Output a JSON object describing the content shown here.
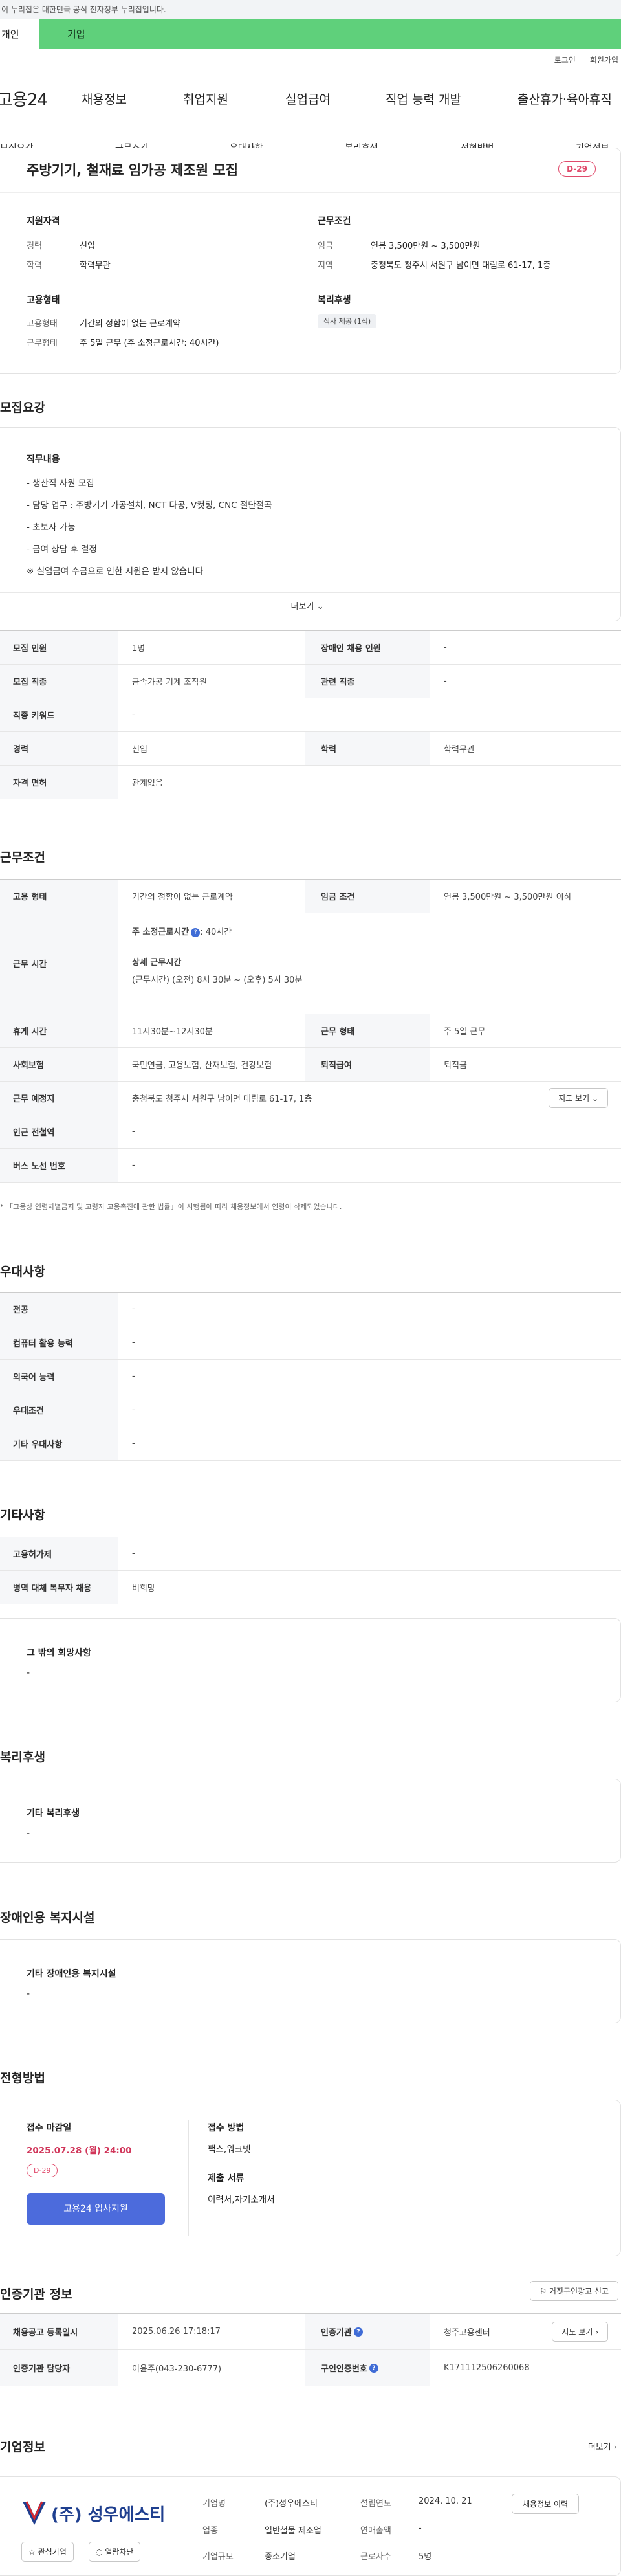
{
  "gov_banner": "이 누리집은 대한민국 공식 전자정부 누리집입니다.",
  "user_tabs": {
    "personal": "개인",
    "business": "기업"
  },
  "util": {
    "login": "로그인",
    "signup": "회원가입"
  },
  "gnb": {
    "logo": "고용24",
    "items": [
      "채용정보",
      "취업지원",
      "실업급여",
      "직업 능력 개발",
      "출산휴가·육아휴직"
    ]
  },
  "subnav": [
    "모집요강",
    "근무조건",
    "우대사항",
    "복리후생",
    "전형방법",
    "기업정보"
  ],
  "hero": {
    "title": "주방기기, 철재료 임가공 제조원 모집",
    "dday": "D-29",
    "qual_title": "지원자격",
    "qual": [
      {
        "k": "경력",
        "v": "신입"
      },
      {
        "k": "학력",
        "v": "학력무관"
      }
    ],
    "work_title": "근무조건",
    "work": [
      {
        "k": "임금",
        "v": "연봉 3,500만원 ~ 3,500만원"
      },
      {
        "k": "지역",
        "v": "충청북도 청주시 서원구 남이면 대림로 61-17, 1층"
      }
    ],
    "emp_title": "고용형태",
    "emp": [
      {
        "k": "고용형태",
        "v": "기간의 정함이 없는 근로계약"
      },
      {
        "k": "근무형태",
        "v": "주 5일 근무 (주 소정근로시간: 40시간)"
      }
    ],
    "welfare_title": "복리후생",
    "welfare_tag": "식사 제공 (1식)"
  },
  "recruit": {
    "heading": "모집요강",
    "desc_title": "직무내용",
    "desc_lines": [
      "- 생산직 사원 모집",
      "- 담당 업무 : 주방기기 가공설치, NCT 타공, V컷팅, CNC 절단절곡",
      "- 초보자 가능",
      "- 급여 상담 후 결정",
      "※ 실업급여 수급으로 인한 지원은 받지 않습니다"
    ],
    "more": "더보기",
    "rows": [
      {
        "k1": "모집 인원",
        "v1": "1명",
        "k2": "장애인 채용 인원",
        "v2": "-"
      },
      {
        "k1": "모집 직종",
        "v1": "금속가공 기계 조작원",
        "k2": "관련 직종",
        "v2": "-"
      },
      {
        "k1": "직종 키워드",
        "v1": "-"
      },
      {
        "k1": "경력",
        "v1": "신입",
        "k2": "학력",
        "v2": "학력무관"
      },
      {
        "k1": "자격 면허",
        "v1": "관계없음"
      }
    ]
  },
  "conditions": {
    "heading": "근무조건",
    "emp_type_k": "고용 형태",
    "emp_type_v": "기간의 정함이 없는 근로계약",
    "wage_k": "임금 조건",
    "wage_v": "연봉 3,500만원 ~ 3,500만원 이하",
    "time_k": "근무 시간",
    "time_main": "주 소정근로시간",
    "time_hours": ": 40시간",
    "time_detail_title": "상세 근무시간",
    "time_detail": "(근무시간) (오전) 8시 30분 ~ (오후) 5시 30분",
    "break_k": "휴게 시간",
    "break_v": "11시30분~12시30분",
    "form_k": "근무 형태",
    "form_v": "주 5일 근무",
    "ins_k": "사회보험",
    "ins_v": "국민연금, 고용보험, 산재보험, 건강보험",
    "ret_k": "퇴직급여",
    "ret_v": "퇴직금",
    "place_k": "근무 예정지",
    "place_v": "충청북도 청주시 서원구 남이면 대림로 61-17, 1층",
    "map_btn": "지도 보기",
    "sub_k": "인근 전철역",
    "sub_v": "-",
    "bus_k": "버스 노선 번호",
    "bus_v": "-",
    "note": "* 「고용상 연령차별금지 및 고령자 고용촉진에 관한 법률」이 시행됨에 따라 채용정보에서 연령이 삭제되었습니다."
  },
  "preference": {
    "heading": "우대사항",
    "rows": [
      {
        "k": "전공",
        "v": "-"
      },
      {
        "k": "컴퓨터 활용 능력",
        "v": "-"
      },
      {
        "k": "외국어 능력",
        "v": "-"
      },
      {
        "k": "우대조건",
        "v": "-"
      },
      {
        "k": "기타 우대사항",
        "v": "-"
      }
    ]
  },
  "etc": {
    "heading": "기타사항",
    "rows": [
      {
        "k": "고용허가제",
        "v": "-"
      },
      {
        "k": "병역 대체 복무자 채용",
        "v": "비희망"
      }
    ],
    "box_title": "그 밖의 희망사항",
    "box_value": "-"
  },
  "welfare": {
    "heading": "복리후생",
    "box_title": "기타 복리후생",
    "box_value": "-"
  },
  "disabled": {
    "heading": "장애인용 복지시설",
    "box_title": "기타 장애인용 복지시설",
    "box_value": "-"
  },
  "apply": {
    "heading": "전형방법",
    "deadline_k": "접수 마감일",
    "deadline_v": "2025.07.28 (월) 24:00",
    "dday": "D-29",
    "btn": "고용24 입사지원",
    "method_k": "접수 방법",
    "method_v": "팩스,워크넷",
    "docs_k": "제출 서류",
    "docs_v": "이력서,자기소개서"
  },
  "agency": {
    "heading": "인증기관 정보",
    "report_btn": "거짓구인광고 신고",
    "reg_date_k": "채용공고 등록일시",
    "reg_date_v": "2025.06.26 17:18:17",
    "agency_k": "인증기관",
    "agency_v": "청주고용센터",
    "map_btn": "지도 보기",
    "manager_k": "인증기관 담당자",
    "manager_v": "이윤주(043-230-6777)",
    "num_k": "구인인증번호",
    "num_v": "K171112506260068"
  },
  "company": {
    "heading": "기업정보",
    "more": "더보기",
    "logo_text": "(주) 성우에스티",
    "fav_btn": "관심기업",
    "block_btn": "열람차단",
    "name_k": "기업명",
    "name_v": "(주)성우에스티",
    "year_k": "설립연도",
    "year_v": "2024. 10. 21",
    "industry_k": "업종",
    "industry_v": "일반철물 제조업",
    "sales_k": "연매출액",
    "sales_v": "-",
    "size_k": "기업규모",
    "size_v": "중소기업",
    "emp_k": "근로자수",
    "emp_v": "5명",
    "history_btn": "채용정보 이력"
  }
}
